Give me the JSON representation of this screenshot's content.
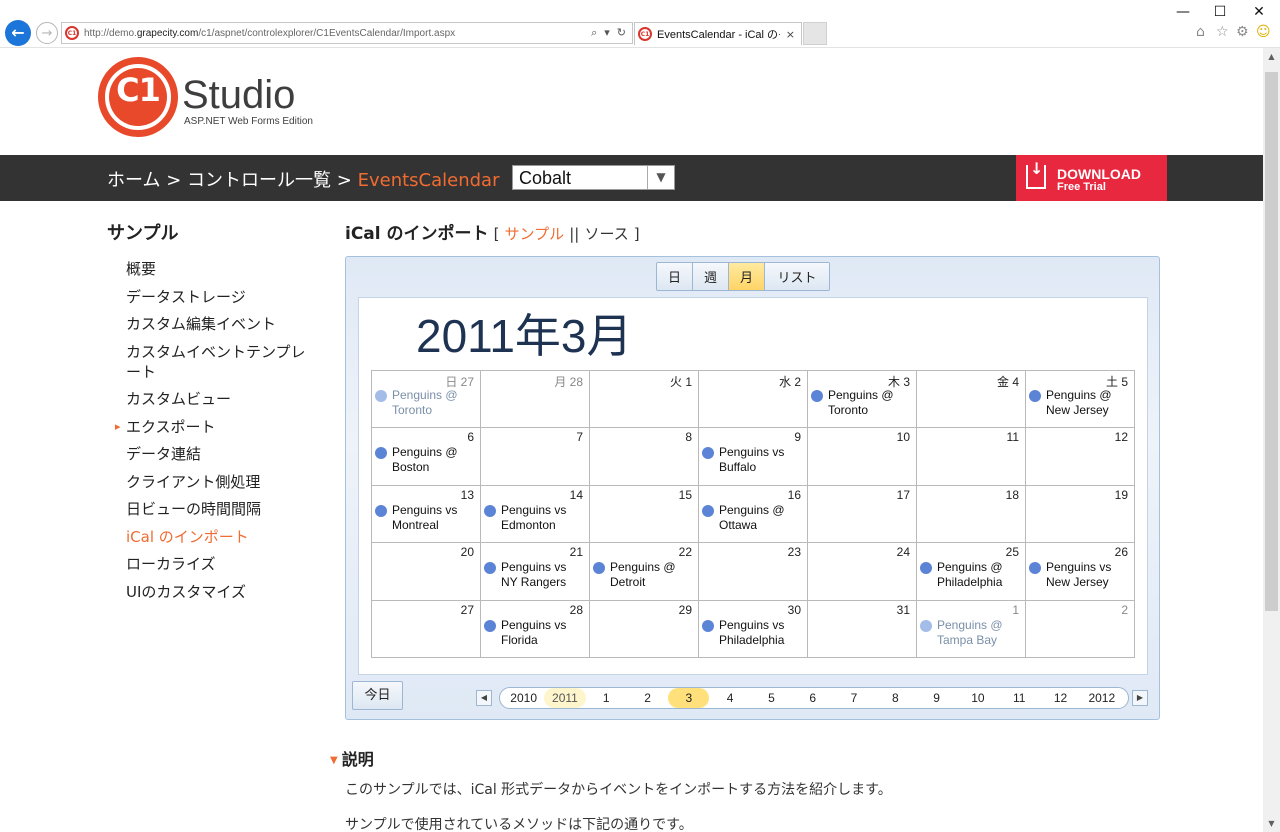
{
  "browser": {
    "url_prefix": "http://demo.",
    "url_domain": "grapecity.com",
    "url_path": "/c1/aspnet/controlexplorer/C1EventsCalendar/Import.aspx",
    "tab_title": "EventsCalendar - iCal のイン...",
    "tab_close": "×",
    "favicon": "C1",
    "back": "←",
    "forward": "→",
    "minimize": "—",
    "maximize": "☐",
    "close": "✕"
  },
  "logo": {
    "mark": "C1",
    "name": "Studio",
    "edition": "ASP.NET Web Forms Edition"
  },
  "nav": {
    "crumb_home": "ホーム",
    "crumb_sep": ">",
    "crumb_list": "コントロール一覧",
    "crumb_current": "EventsCalendar",
    "theme_value": "Cobalt",
    "download_title": "DOWNLOAD",
    "download_sub": "Free Trial"
  },
  "sidebar": {
    "heading": "サンプル",
    "items": [
      {
        "label": "概要"
      },
      {
        "label": "データストレージ"
      },
      {
        "label": "カスタム編集イベント"
      },
      {
        "label": "カスタムイベントテンプレート"
      },
      {
        "label": "カスタムビュー"
      },
      {
        "label": "エクスポート"
      },
      {
        "label": "データ連結"
      },
      {
        "label": "クライアント側処理"
      },
      {
        "label": "日ビューの時間間隔"
      },
      {
        "label": "iCal のインポート"
      },
      {
        "label": "ローカライズ"
      },
      {
        "label": "UIのカスタマイズ"
      }
    ]
  },
  "content": {
    "title": "iCal のインポート",
    "bracket_open": "[",
    "link_sample": "サンプル",
    "link_sep": "||",
    "link_source": "ソース",
    "bracket_close": "]",
    "views": [
      "日",
      "週",
      "月",
      "リスト"
    ],
    "active_view": "月",
    "month_heading": "2011年3月",
    "today": "今日",
    "pager_prev": "◀",
    "pager_next": "▶",
    "pager": [
      "2010",
      "2011",
      "1",
      "2",
      "3",
      "4",
      "5",
      "6",
      "7",
      "8",
      "9",
      "10",
      "11",
      "12",
      "2012"
    ],
    "pager_current": "3",
    "pager_year": "2011",
    "desc_heading": "説明",
    "desc_para1": "このサンプルでは、iCal 形式データからイベントをインポートする方法を紹介します。",
    "desc_para2": "サンプルで使用されているメソッドは下記の通りです。"
  },
  "calendar": {
    "cells": [
      {
        "day": "日 27",
        "other": true,
        "event": "Penguins @ Toronto"
      },
      {
        "day": "月 28",
        "other": true,
        "event": ""
      },
      {
        "day": "火 1",
        "other": false,
        "event": ""
      },
      {
        "day": "水 2",
        "other": false,
        "event": ""
      },
      {
        "day": "木 3",
        "other": false,
        "event": "Penguins @ Toronto"
      },
      {
        "day": "金 4",
        "other": false,
        "event": ""
      },
      {
        "day": "土 5",
        "other": false,
        "event": "Penguins @ New Jersey"
      },
      {
        "day": "6",
        "other": false,
        "event": "Penguins @ Boston"
      },
      {
        "day": "7",
        "other": false,
        "event": ""
      },
      {
        "day": "8",
        "other": false,
        "event": ""
      },
      {
        "day": "9",
        "other": false,
        "event": "Penguins vs Buffalo"
      },
      {
        "day": "10",
        "other": false,
        "event": ""
      },
      {
        "day": "11",
        "other": false,
        "event": ""
      },
      {
        "day": "12",
        "other": false,
        "event": ""
      },
      {
        "day": "13",
        "other": false,
        "event": "Penguins vs Montreal"
      },
      {
        "day": "14",
        "other": false,
        "event": "Penguins vs Edmonton"
      },
      {
        "day": "15",
        "other": false,
        "event": ""
      },
      {
        "day": "16",
        "other": false,
        "event": "Penguins @ Ottawa"
      },
      {
        "day": "17",
        "other": false,
        "event": ""
      },
      {
        "day": "18",
        "other": false,
        "event": ""
      },
      {
        "day": "19",
        "other": false,
        "event": ""
      },
      {
        "day": "20",
        "other": false,
        "event": ""
      },
      {
        "day": "21",
        "other": false,
        "event": "Penguins vs NY Rangers"
      },
      {
        "day": "22",
        "other": false,
        "event": "Penguins @ Detroit"
      },
      {
        "day": "23",
        "other": false,
        "event": ""
      },
      {
        "day": "24",
        "other": false,
        "event": ""
      },
      {
        "day": "25",
        "other": false,
        "event": "Penguins @ Philadelphia"
      },
      {
        "day": "26",
        "other": false,
        "event": "Penguins vs New Jersey"
      },
      {
        "day": "27",
        "other": false,
        "event": ""
      },
      {
        "day": "28",
        "other": false,
        "event": "Penguins vs Florida"
      },
      {
        "day": "29",
        "other": false,
        "event": ""
      },
      {
        "day": "30",
        "other": false,
        "event": "Penguins vs Philadelphia"
      },
      {
        "day": "31",
        "other": false,
        "event": ""
      },
      {
        "day": "1",
        "other": true,
        "event": "Penguins @ Tampa Bay"
      },
      {
        "day": "2",
        "other": true,
        "event": ""
      }
    ]
  },
  "colors": {
    "accent": "#f06c32",
    "navbar": "#333333",
    "download": "#e8283e",
    "event_dot": "#5b83d6"
  }
}
